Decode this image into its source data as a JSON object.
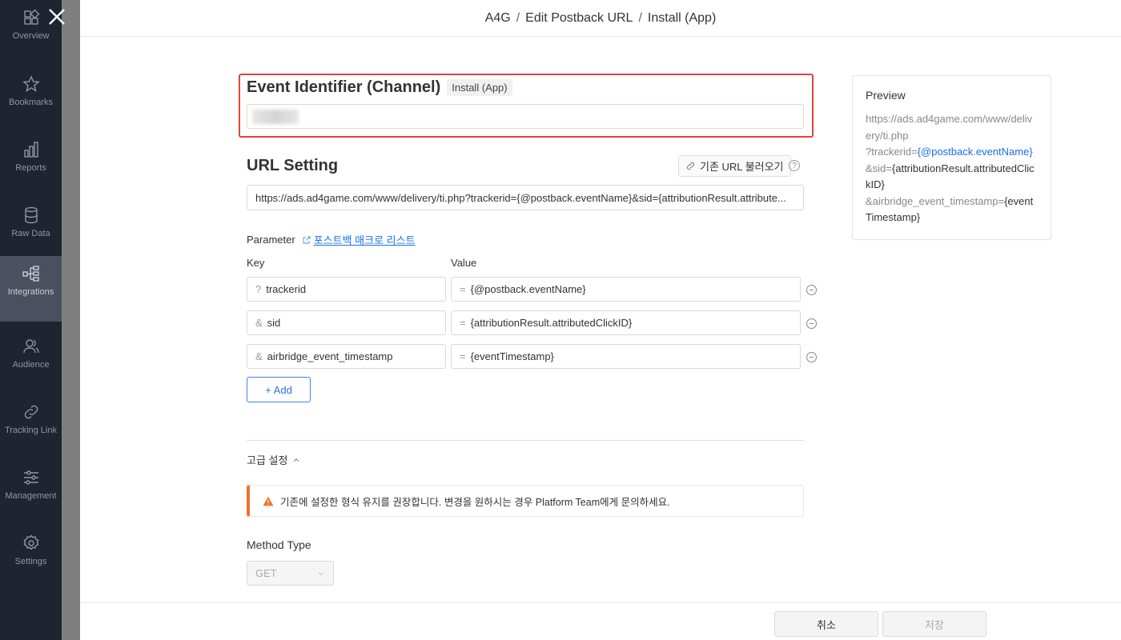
{
  "sidebar": {
    "items": [
      {
        "label": "Overview",
        "icon": "grid-icon"
      },
      {
        "label": "Bookmarks",
        "icon": "star-icon"
      },
      {
        "label": "Reports",
        "icon": "bar-chart-icon"
      },
      {
        "label": "Raw Data",
        "icon": "database-icon"
      },
      {
        "label": "Integrations",
        "icon": "hierarchy-icon",
        "active": true
      },
      {
        "label": "Audience",
        "icon": "users-icon"
      },
      {
        "label": "Tracking Link",
        "icon": "link-icon"
      },
      {
        "label": "Management",
        "icon": "sliders-icon"
      },
      {
        "label": "Settings",
        "icon": "gear-icon"
      }
    ]
  },
  "header": {
    "crumb1": "A4G",
    "crumb2": "Edit Postback URL",
    "crumb3": "Install (App)"
  },
  "event": {
    "title": "Event Identifier (Channel)",
    "tag": "Install (App)"
  },
  "url_setting": {
    "title": "URL Setting",
    "load_button": "기존 URL 불러오기",
    "help": "?",
    "url_value": "https://ads.ad4game.com/www/delivery/ti.php?trackerid={@postback.eventName}&sid={attributionResult.attribute..."
  },
  "parameter": {
    "label": "Parameter",
    "link": "포스트백 매크로 리스트",
    "col_key": "Key",
    "col_value": "Value",
    "rows": [
      {
        "prefix": "?",
        "key": "trackerid",
        "value": "{@postback.eventName}"
      },
      {
        "prefix": "&",
        "key": "sid",
        "value": "{attributionResult.attributedClickID}"
      },
      {
        "prefix": "&",
        "key": "airbridge_event_timestamp",
        "value": "{eventTimestamp}"
      }
    ],
    "value_prefix": "=",
    "add_button": "+ Add"
  },
  "advanced": {
    "label": "고급 설정",
    "warning": "기존에 설정한 형식 유지를 권장합니다. 변경을 원하시는 경우 Platform Team에게 문의하세요."
  },
  "method": {
    "label": "Method Type",
    "value": "GET"
  },
  "preview": {
    "title": "Preview",
    "line1": "https://ads.ad4game.com/www/delivery/ti.php",
    "line2_prefix": "?trackerid=",
    "line2_macro": "{@postback.eventName}",
    "line3_prefix": "&sid=",
    "line3_macro": "{attributionResult.attributedClickID}",
    "line4_prefix": "&airbridge_event_timestamp=",
    "line4_macro": "{eventTimestamp}"
  },
  "footer": {
    "cancel": "취소",
    "save": "저장"
  },
  "colors": {
    "highlight_border": "#e0443e",
    "accent_blue": "#1a73e8",
    "warning_orange": "#f0712c",
    "sidebar_bg": "#1f2530"
  }
}
